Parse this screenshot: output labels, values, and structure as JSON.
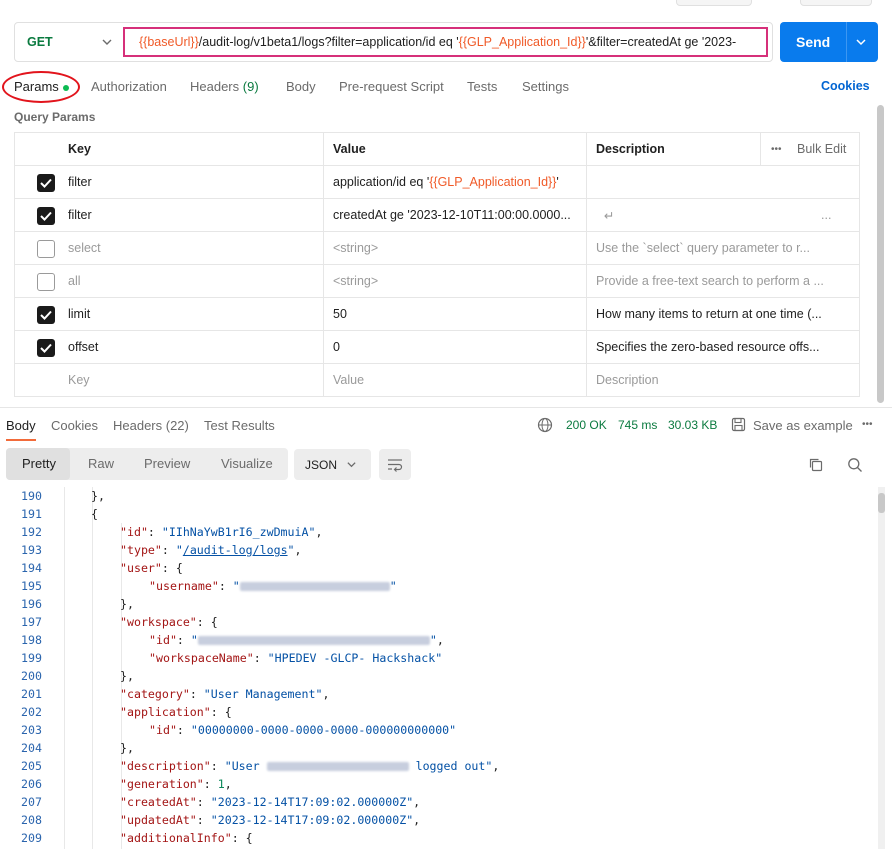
{
  "request": {
    "method": "GET",
    "url_parts": [
      {
        "t": "{{baseUrl}}",
        "var": true
      },
      {
        "t": "/audit-log/v1beta1/logs?filter=application/id eq '",
        "var": false
      },
      {
        "t": "{{GLP_Application_Id}}",
        "var": true
      },
      {
        "t": "'&filter=createdAt ge '2023-",
        "var": false
      }
    ],
    "send_label": "Send"
  },
  "tabs": {
    "params": "Params",
    "authorization": "Authorization",
    "headers": "Headers",
    "headers_count": "(9)",
    "body": "Body",
    "prerequest": "Pre-request Script",
    "tests": "Tests",
    "settings": "Settings",
    "cookies": "Cookies"
  },
  "query_params": {
    "label": "Query Params",
    "columns": {
      "key": "Key",
      "value": "Value",
      "description": "Description",
      "bulk_edit": "Bulk Edit",
      "more": "•••"
    },
    "rows": [
      {
        "checked": true,
        "key": "filter",
        "value": "application/id eq '",
        "value_var": "{{GLP_Application_Id}}",
        "value_tail": "'",
        "description": ""
      },
      {
        "checked": true,
        "key": "filter",
        "value": "createdAt ge '2023-12-10T11:00:00.0000...",
        "value_var": "",
        "value_tail": "",
        "description": "↵",
        "desc_more": "..."
      },
      {
        "checked": false,
        "key": "select",
        "value": "<string>",
        "value_var": "",
        "value_tail": "",
        "description": "Use the `select` query parameter to r..."
      },
      {
        "checked": false,
        "key": "all",
        "value": "<string>",
        "value_var": "",
        "value_tail": "",
        "description": "Provide a free-text search to perform a ..."
      },
      {
        "checked": true,
        "key": "limit",
        "value": "50",
        "value_var": "",
        "value_tail": "",
        "description": "How many items to return at one time (..."
      },
      {
        "checked": true,
        "key": "offset",
        "value": "0",
        "value_var": "",
        "value_tail": "",
        "description": "Specifies the zero-based resource offs..."
      }
    ],
    "placeholder": {
      "key": "Key",
      "value": "Value",
      "description": "Description"
    }
  },
  "response": {
    "tabs": {
      "body": "Body",
      "cookies": "Cookies",
      "headers": "Headers (22)",
      "tests": "Test Results"
    },
    "status": "200 OK",
    "time": "745 ms",
    "size": "30.03 KB",
    "save": "Save as example",
    "more": "•••",
    "views": {
      "pretty": "Pretty",
      "raw": "Raw",
      "preview": "Preview",
      "visualize": "Visualize"
    },
    "format": "JSON"
  },
  "code_lines": [
    {
      "n": "190",
      "i": 2,
      "tk": [
        [
          "p",
          "},"
        ]
      ]
    },
    {
      "n": "191",
      "i": 2,
      "tk": [
        [
          "p",
          "{"
        ]
      ]
    },
    {
      "n": "192",
      "i": 3,
      "tk": [
        [
          "k",
          "\"id\""
        ],
        [
          "p",
          ": "
        ],
        [
          "s",
          "\"IIhNaYwB1rI6_zwDmuiA\""
        ],
        [
          "p",
          ","
        ]
      ]
    },
    {
      "n": "193",
      "i": 3,
      "tk": [
        [
          "k",
          "\"type\""
        ],
        [
          "p",
          ": "
        ],
        [
          "s",
          "\""
        ],
        [
          "u",
          "/audit-log/logs"
        ],
        [
          "s",
          "\""
        ],
        [
          "p",
          ","
        ]
      ]
    },
    {
      "n": "194",
      "i": 3,
      "tk": [
        [
          "k",
          "\"user\""
        ],
        [
          "p",
          ": {"
        ]
      ]
    },
    {
      "n": "195",
      "i": 4,
      "tk": [
        [
          "k",
          "\"username\""
        ],
        [
          "p",
          ": "
        ],
        [
          "s",
          "\""
        ],
        [
          "b",
          "150"
        ],
        [
          "s",
          "\""
        ]
      ]
    },
    {
      "n": "196",
      "i": 3,
      "tk": [
        [
          "p",
          "},"
        ]
      ]
    },
    {
      "n": "197",
      "i": 3,
      "tk": [
        [
          "k",
          "\"workspace\""
        ],
        [
          "p",
          ": {"
        ]
      ]
    },
    {
      "n": "198",
      "i": 4,
      "tk": [
        [
          "k",
          "\"id\""
        ],
        [
          "p",
          ": "
        ],
        [
          "s",
          "\""
        ],
        [
          "b",
          "232"
        ],
        [
          "s",
          "\""
        ],
        [
          "p",
          ","
        ]
      ]
    },
    {
      "n": "199",
      "i": 4,
      "tk": [
        [
          "k",
          "\"workspaceName\""
        ],
        [
          "p",
          ": "
        ],
        [
          "s",
          "\"HPEDEV -GLCP- Hackshack\""
        ]
      ]
    },
    {
      "n": "200",
      "i": 3,
      "tk": [
        [
          "p",
          "},"
        ]
      ]
    },
    {
      "n": "201",
      "i": 3,
      "tk": [
        [
          "k",
          "\"category\""
        ],
        [
          "p",
          ": "
        ],
        [
          "s",
          "\"User Management\""
        ],
        [
          "p",
          ","
        ]
      ]
    },
    {
      "n": "202",
      "i": 3,
      "tk": [
        [
          "k",
          "\"application\""
        ],
        [
          "p",
          ": {"
        ]
      ]
    },
    {
      "n": "203",
      "i": 4,
      "tk": [
        [
          "k",
          "\"id\""
        ],
        [
          "p",
          ": "
        ],
        [
          "s",
          "\"00000000-0000-0000-0000-000000000000\""
        ]
      ]
    },
    {
      "n": "204",
      "i": 3,
      "tk": [
        [
          "p",
          "},"
        ]
      ]
    },
    {
      "n": "205",
      "i": 3,
      "tk": [
        [
          "k",
          "\"description\""
        ],
        [
          "p",
          ": "
        ],
        [
          "s",
          "\"User "
        ],
        [
          "b",
          "142"
        ],
        [
          "s",
          " logged out\""
        ],
        [
          "p",
          ","
        ]
      ]
    },
    {
      "n": "206",
      "i": 3,
      "tk": [
        [
          "k",
          "\"generation\""
        ],
        [
          "p",
          ": "
        ],
        [
          "n",
          "1"
        ],
        [
          "p",
          ","
        ]
      ]
    },
    {
      "n": "207",
      "i": 3,
      "tk": [
        [
          "k",
          "\"createdAt\""
        ],
        [
          "p",
          ": "
        ],
        [
          "s",
          "\"2023-12-14T17:09:02.000000Z\""
        ],
        [
          "p",
          ","
        ]
      ]
    },
    {
      "n": "208",
      "i": 3,
      "tk": [
        [
          "k",
          "\"updatedAt\""
        ],
        [
          "p",
          ": "
        ],
        [
          "s",
          "\"2023-12-14T17:09:02.000000Z\""
        ],
        [
          "p",
          ","
        ]
      ]
    },
    {
      "n": "209",
      "i": 3,
      "tk": [
        [
          "k",
          "\"additionalInfo\""
        ],
        [
          "p",
          ": {"
        ]
      ]
    }
  ],
  "icons": {
    "method_dropdown": "chevron-down-icon",
    "send_dropdown": "chevron-down-icon",
    "globe": "globe-icon",
    "save": "save-icon",
    "wrap": "wrap-lines-icon",
    "copy": "copy-icon",
    "search": "search-icon"
  },
  "colors": {
    "accent": "#097bed",
    "variable": "#f05a28",
    "url_highlight": "#d6307a",
    "status_ok": "#0a7a3f",
    "annotation": "#e2141c"
  }
}
